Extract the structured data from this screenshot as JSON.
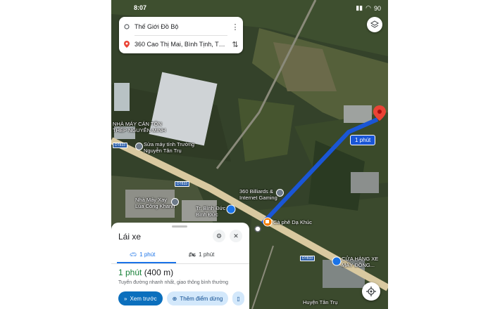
{
  "status_bar": {
    "time": "8:07",
    "battery": "90"
  },
  "search": {
    "origin": "Thế Giới Đồ Bộ",
    "destination": "360 Cao Thị Mai, Bình Tịnh, Tâ...",
    "more_icon": "more-vert-icon",
    "swap_icon": "swap-icon"
  },
  "map": {
    "labels": {
      "factory": "NHÀ MÁY CÁN TÔN\nTHÉP NGUYỄN MINH",
      "computer_repair": "Sửa máy tính Trường\nNguyễn Tân Trụ",
      "rice_mill": "Nhà Máy Xay\nLúa Công Khanh",
      "school": "Tr. Bình Đức\nBình Đức",
      "billiards": "360 Billiards &\nInternet Gaming",
      "cafe": "Cà phê Dạ Khúc",
      "motorbike_shop": "CỬA HÀNG XE\nMÁY ĐỒNG...",
      "district": "Huyện Tân Trụ",
      "road_dt833a": "DT833",
      "road_dt833b": "DT833",
      "road_dt833c": "DT833"
    },
    "eta_label": "1 phút",
    "colors": {
      "route": "#1a56d6",
      "destination_pin": "#ea4335",
      "cafe_pin": "#f57c00"
    }
  },
  "sheet": {
    "title": "Lái xe",
    "tabs": [
      {
        "label": "1 phút",
        "icon": "car-icon",
        "active": true
      },
      {
        "label": "1 phút",
        "icon": "motorbike-icon",
        "active": false
      }
    ],
    "duration": "1 phút",
    "distance": "(400 m)",
    "description": "Tuyến đường nhanh nhất, giao thông bình thường",
    "buttons": {
      "preview": "Xem trước",
      "add_stop": "Thêm điểm dừng"
    }
  }
}
